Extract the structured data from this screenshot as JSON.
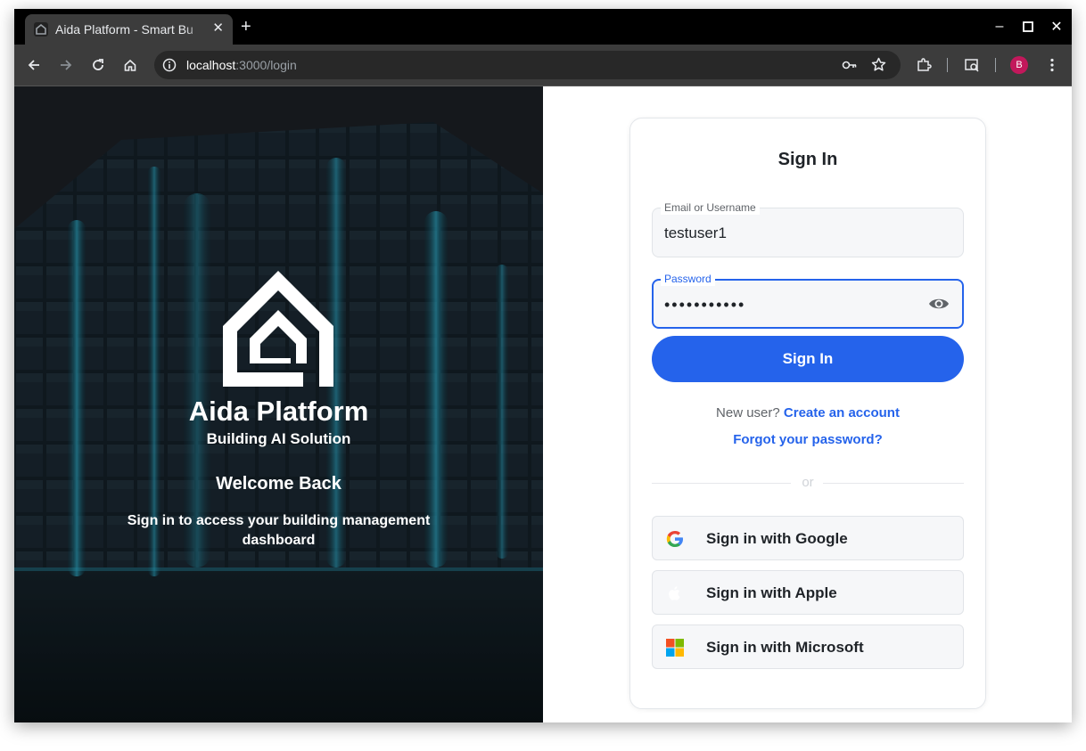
{
  "browser": {
    "tab_title": "Aida Platform - Smart Bu",
    "tab_close": "✕",
    "new_tab": "+",
    "url_host": "localhost",
    "url_path": ":3000/login",
    "profile_initial": "B",
    "window_controls": {
      "minimize": "–",
      "maximize": "☐",
      "close": "✕"
    }
  },
  "hero": {
    "brand_title": "Aida Platform",
    "brand_subtitle": "Building AI Solution",
    "welcome_title": "Welcome Back",
    "welcome_description": "Sign in to access your building management dashboard"
  },
  "login": {
    "title": "Sign In",
    "email_label": "Email or Username",
    "email_value": "testuser1",
    "password_label": "Password",
    "password_value": "•••••••••••",
    "submit_label": "Sign In",
    "new_user_text": "New user?",
    "create_account_link": "Create an account",
    "forgot_password_link": "Forgot your password?",
    "divider_text": "or",
    "social": {
      "google": "Sign in with Google",
      "apple": "Sign in with Apple",
      "microsoft": "Sign in with Microsoft"
    }
  },
  "colors": {
    "accent": "#2563eb",
    "hero_glow": "#2fb7d6",
    "profile": "#c2185b"
  }
}
